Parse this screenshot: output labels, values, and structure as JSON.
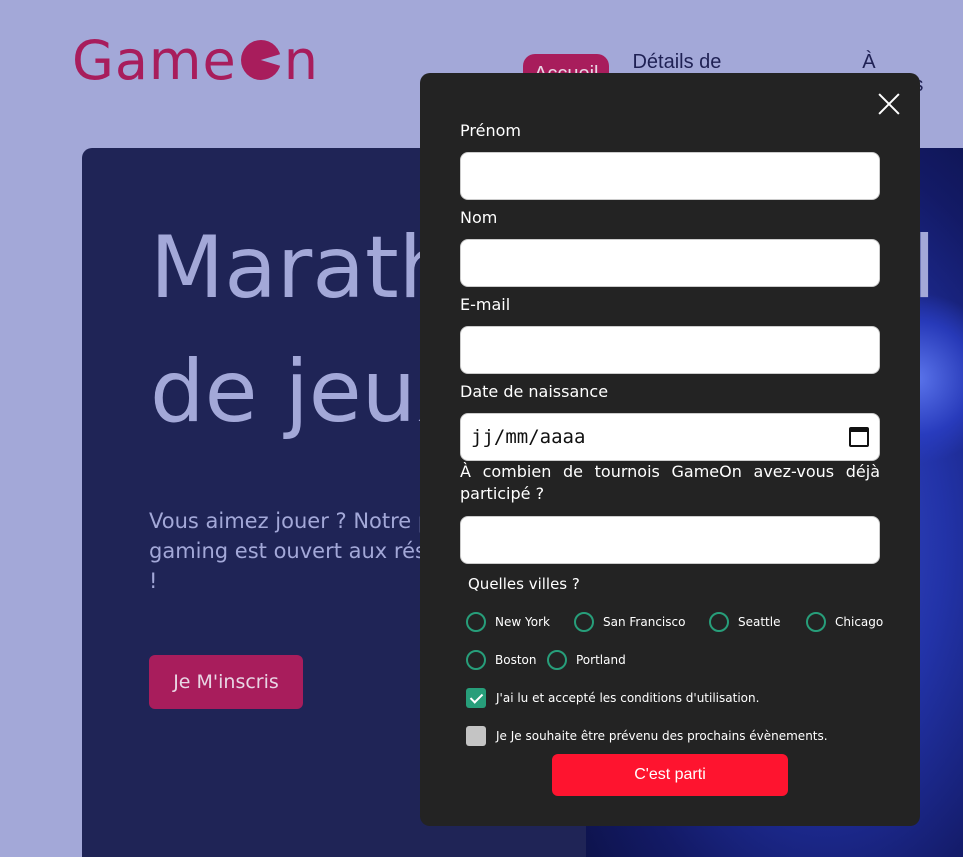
{
  "header": {
    "logo_left": "Game",
    "logo_right": "n",
    "nav": [
      {
        "label": "Accueil",
        "active": true
      },
      {
        "label": "Détails de l'évènement",
        "active": false
      },
      {
        "label": "À propos",
        "active": false
      }
    ]
  },
  "hero": {
    "title_line1": "Marathon national",
    "title_line2": "de jeux vidéos",
    "text": "Vous aimez jouer ? Notre prochain évènement gaming est ouvert aux réservations... Places limitées !",
    "cta": "Je M'inscris"
  },
  "modal": {
    "fields": {
      "first_name_label": "Prénom",
      "last_name_label": "Nom",
      "email_label": "E-mail",
      "birthdate_label": "Date de naissance",
      "birthdate_placeholder": "jj/mm/aaaa",
      "tournaments_label": "À combien de tournois GameOn avez-vous déjà participé ?",
      "cities_label": "Quelles villes ?"
    },
    "cities": [
      "New York",
      "San Francisco",
      "Seattle",
      "Chicago",
      "Boston",
      "Portland"
    ],
    "checkboxes": {
      "terms": "J'ai lu et accepté les conditions d'utilisation.",
      "newsletter": "Je Je souhaite être prévenu des prochains évènements."
    },
    "submit": "C'est parti"
  },
  "colors": {
    "brand": "#a81d5c",
    "background": "#a3a8d8",
    "hero_bg": "#1f2456",
    "modal_bg": "#232323",
    "accent_green": "#279e7a",
    "submit_red": "#fe142f"
  }
}
